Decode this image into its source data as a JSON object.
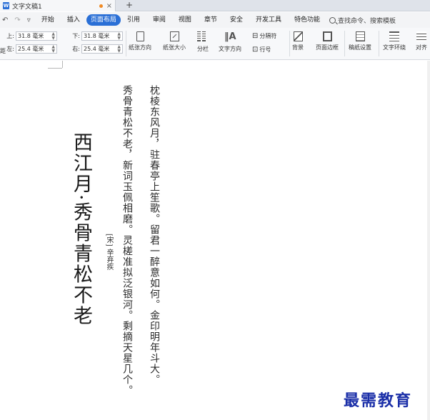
{
  "window": {
    "tab_title": "文字文稿1",
    "new_tab": "+",
    "close": "×"
  },
  "menu": {
    "items": [
      "开始",
      "插入",
      "页面布局",
      "引用",
      "审阅",
      "视图",
      "章节",
      "安全",
      "开发工具",
      "特色功能"
    ],
    "active": "页面布局",
    "search_text": "查找命令、搜索模板"
  },
  "ribbon": {
    "margins": {
      "top_label": "上:",
      "top_value": "31.8 毫米",
      "bottom_label": "下:",
      "bottom_value": "31.8 毫米",
      "left_label": "左:",
      "left_value": "25.4 毫米",
      "right_label": "右:",
      "right_value": "25.4 毫米",
      "edge_label": "距"
    },
    "orientation_label": "纸张方向",
    "size_label": "纸张大小",
    "columns_label": "分栏",
    "text_direction_label": "文字方向",
    "break_label": "分隔符",
    "line_number_label": "行号",
    "background_label": "背景",
    "page_border_label": "页面边框",
    "manuscript_label": "稿纸设置",
    "text_wrap_label": "文字环绕",
    "align_label": "对齐"
  },
  "document": {
    "title": "西江月·秀骨青松不老",
    "author": "[宋] 辛弃疾",
    "line1": "秀骨青松不老，新词玉佩相磨。灵槎准拟泛银河。剩摘天星几个。",
    "line2": "枕棱东风月，驻春亭上笙歌。留君一醉意如何。金印明年斗大。"
  },
  "watermark": "最需教育"
}
